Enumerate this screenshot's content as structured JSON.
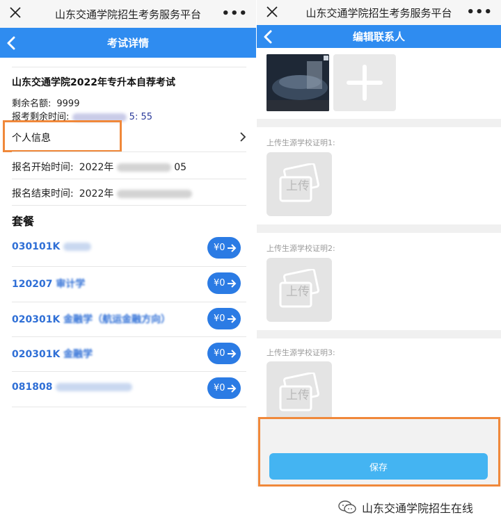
{
  "left": {
    "window_title": "山东交通学院招生考务服务平台",
    "header_title": "考试详情",
    "exam_title": "山东交通学院2022年专升本自荐考试",
    "remaining_quota_label": "剩余名额:",
    "remaining_quota_value": "9999",
    "remaining_time_label": "报考剩余时间:",
    "remaining_time_value": "5: 55",
    "personal_info_label": "个人信息",
    "reg_start_label": "报名开始时间:",
    "reg_start_value": "2022年",
    "reg_start_suffix": "05",
    "reg_end_label": "报名结束时间:",
    "reg_end_value": "2022年",
    "packages_title": "套餐",
    "packages": [
      {
        "code": "030101K",
        "name_fragment": "",
        "price": "¥0"
      },
      {
        "code": "120207",
        "name_fragment": "审计学",
        "price": "¥0"
      },
      {
        "code": "020301K",
        "name_fragment": "金融学（航运金融方向）",
        "price": "¥0"
      },
      {
        "code": "020301K",
        "name_fragment": "金融学",
        "price": "¥0"
      },
      {
        "code": "081808",
        "name_fragment": "",
        "price": "¥0"
      }
    ]
  },
  "right": {
    "window_title": "山东交通学院招生考务服务平台",
    "header_title": "编辑联系人",
    "upload_sections": [
      {
        "label": "上传生源学校证明1:",
        "button_text": "上传"
      },
      {
        "label": "上传生源学校证明2:",
        "button_text": "上传"
      },
      {
        "label": "上传生源学校证明3:",
        "button_text": "上传"
      }
    ],
    "save_label": "保存"
  },
  "watermark": {
    "text": "山东交通学院招生在线"
  },
  "colors": {
    "accent_blue": "#2f8cf0",
    "highlight_orange": "#f0883a",
    "price_button": "#2b7be4",
    "save_button": "#44b4f2"
  }
}
